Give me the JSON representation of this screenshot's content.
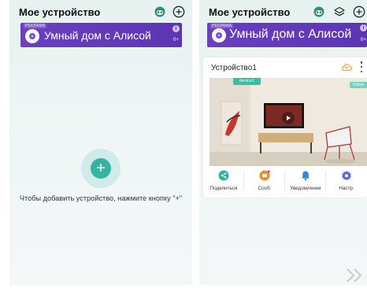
{
  "left_screen": {
    "header": {
      "title": "Мое устройство"
    },
    "banner": {
      "ad_label": "РЕКЛАМА",
      "text": "Умный дом с Алисой",
      "info_icon": "i",
      "age_rating": "0+"
    },
    "empty_state": {
      "add_icon": "+",
      "hint": "Чтобы добавить устройство, нажмите кнопку \"+\""
    }
  },
  "right_screen": {
    "header": {
      "title": "Мое устройство"
    },
    "banner": {
      "ad_label": "РЕКЛАМА",
      "text": "Умный дом с Алисой",
      "info_icon": "i",
      "age_rating": "0+"
    },
    "device_card": {
      "name": "Устройство1",
      "thumbnail_tag": "device1",
      "status": "Online",
      "actions": [
        {
          "label": "Поделиться",
          "icon": "share-icon",
          "color": "#2fb59c"
        },
        {
          "label": "Сооб.",
          "icon": "message-icon",
          "color": "#f08a2c"
        },
        {
          "label": "Уведомление",
          "icon": "bell-icon",
          "color": "#2d8be0"
        },
        {
          "label": "Настр.",
          "icon": "gear-icon",
          "color": "#5c6bd1"
        }
      ]
    }
  },
  "colors": {
    "accent": "#37b3a4",
    "banner": "#5d35b4",
    "cloud_upload": "#f2a23a"
  }
}
